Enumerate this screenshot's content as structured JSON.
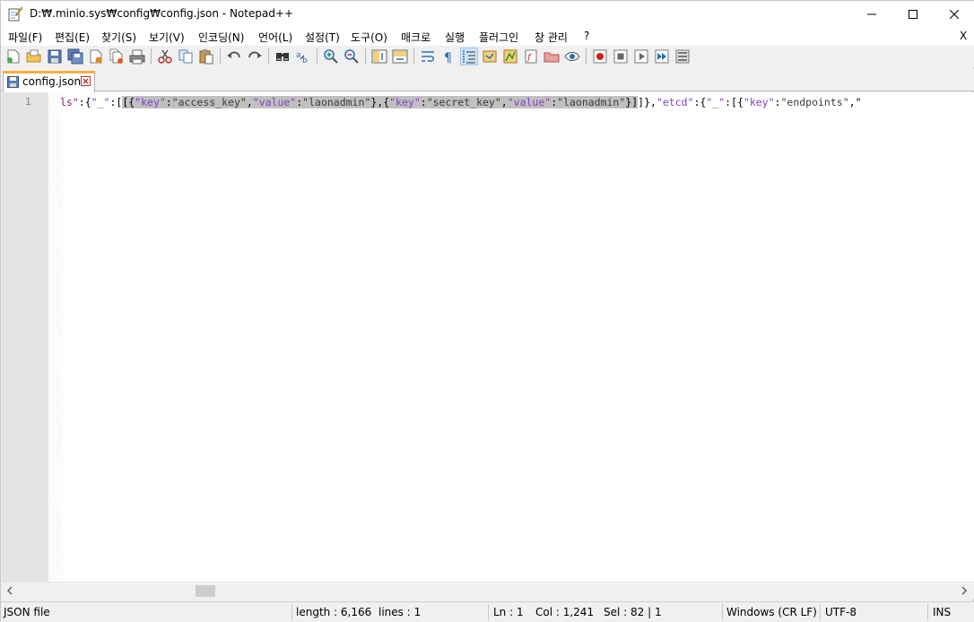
{
  "window": {
    "title": "D:₩.minio.sys₩config₩config.json - Notepad++"
  },
  "menu": {
    "items": [
      "파일(F)",
      "편집(E)",
      "찾기(S)",
      "보기(V)",
      "인코딩(N)",
      "언어(L)",
      "설정(T)",
      "도구(O)",
      "매크로",
      "실행",
      "플러그인",
      "창 관리",
      "?"
    ],
    "close_doc": "X"
  },
  "toolbar": {
    "icons": [
      "new-file-icon",
      "open-file-icon",
      "save-icon",
      "save-all-icon",
      "close-icon",
      "close-all-icon",
      "print-icon",
      "cut-icon",
      "copy-icon",
      "paste-icon",
      "undo-icon",
      "redo-icon",
      "find-icon",
      "replace-icon",
      "zoom-in-icon",
      "zoom-out-icon",
      "sync-vertical-icon",
      "sync-horizontal-icon",
      "word-wrap-icon",
      "show-all-chars-icon",
      "indent-guide-icon",
      "user-lang-icon",
      "doc-map-icon",
      "function-list-icon",
      "folder-workspace-icon",
      "monitoring-icon",
      "record-macro-icon",
      "stop-macro-icon",
      "play-macro-icon",
      "run-macro-multiple-icon",
      "save-macro-icon"
    ],
    "active": "indent-guide-icon"
  },
  "tab": {
    "label": "config.json"
  },
  "editor": {
    "line_number": "1",
    "segments": [
      {
        "t": "ls\"",
        "c": "pre"
      },
      {
        "t": ":",
        "c": "p"
      },
      {
        "t": "{",
        "c": "p"
      },
      {
        "t": "\"_\"",
        "c": "k"
      },
      {
        "t": ":",
        "c": "p"
      },
      {
        "t": "[",
        "c": "p"
      },
      {
        "t": "[{",
        "c": "p",
        "sel": true
      },
      {
        "t": "\"key\"",
        "c": "k",
        "sel": true
      },
      {
        "t": ":",
        "c": "p",
        "sel": true
      },
      {
        "t": "\"access_key\"",
        "c": "str",
        "sel": true
      },
      {
        "t": ",",
        "c": "p",
        "sel": true
      },
      {
        "t": "\"value\"",
        "c": "k",
        "sel": true
      },
      {
        "t": ":",
        "c": "p",
        "sel": true
      },
      {
        "t": "\"laonadmin\"",
        "c": "str",
        "sel": true
      },
      {
        "t": "},{",
        "c": "p",
        "sel": true
      },
      {
        "t": "\"key\"",
        "c": "k",
        "sel": true
      },
      {
        "t": ":",
        "c": "p",
        "sel": true
      },
      {
        "t": "\"secret_key\"",
        "c": "str",
        "sel": true
      },
      {
        "t": ",",
        "c": "p",
        "sel": true
      },
      {
        "t": "\"value\"",
        "c": "k",
        "sel": true
      },
      {
        "t": ":",
        "c": "p",
        "sel": true
      },
      {
        "t": "\"laonadmin\"",
        "c": "str",
        "sel": true
      },
      {
        "t": "}]",
        "c": "p",
        "sel": true
      },
      {
        "t": "]},",
        "c": "p"
      },
      {
        "t": "\"etcd\"",
        "c": "k"
      },
      {
        "t": ":{",
        "c": "p"
      },
      {
        "t": "\"_\"",
        "c": "k"
      },
      {
        "t": ":[{",
        "c": "p"
      },
      {
        "t": "\"key\"",
        "c": "k"
      },
      {
        "t": ":",
        "c": "p"
      },
      {
        "t": "\"endpoints\"",
        "c": "str"
      },
      {
        "t": ",\"",
        "c": "p"
      }
    ]
  },
  "status": {
    "filetype": "JSON file",
    "length": "length : 6,166",
    "lines": "lines : 1",
    "ln": "Ln : 1",
    "col": "Col : 1,241",
    "sel": "Sel : 82 | 1",
    "eol": "Windows (CR LF)",
    "encoding": "UTF-8",
    "mode": "INS"
  }
}
